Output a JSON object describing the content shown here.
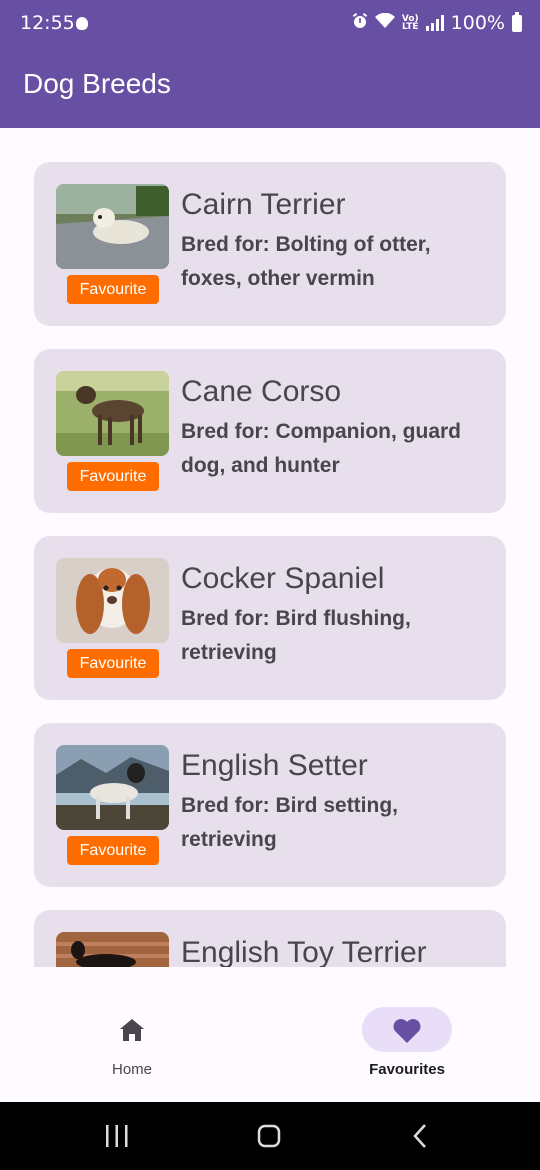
{
  "status_bar": {
    "time": "12:55",
    "battery": "100%"
  },
  "app_bar": {
    "title": "Dog Breeds"
  },
  "breeds": [
    {
      "name": "Cairn Terrier",
      "bred_for": "Bred for: Bolting of otter, foxes, other vermin",
      "badge": "Favourite"
    },
    {
      "name": "Cane Corso",
      "bred_for": "Bred for: Companion, guard dog, and hunter",
      "badge": "Favourite"
    },
    {
      "name": "Cocker Spaniel",
      "bred_for": "Bred for: Bird flushing, retrieving",
      "badge": "Favourite"
    },
    {
      "name": "English Setter",
      "bred_for": "Bred for: Bird setting, retrieving",
      "badge": "Favourite"
    },
    {
      "name": "English Toy Terrier",
      "bred_for": "",
      "badge": ""
    }
  ],
  "bottom_nav": {
    "items": [
      {
        "label": "Home",
        "icon": "home-icon",
        "selected": false
      },
      {
        "label": "Favourites",
        "icon": "heart-icon",
        "selected": true
      }
    ]
  },
  "colors": {
    "primary": "#6750a4",
    "card": "#e7e0ec",
    "badge": "#ff6d00",
    "nav_indicator": "#e8def8"
  }
}
